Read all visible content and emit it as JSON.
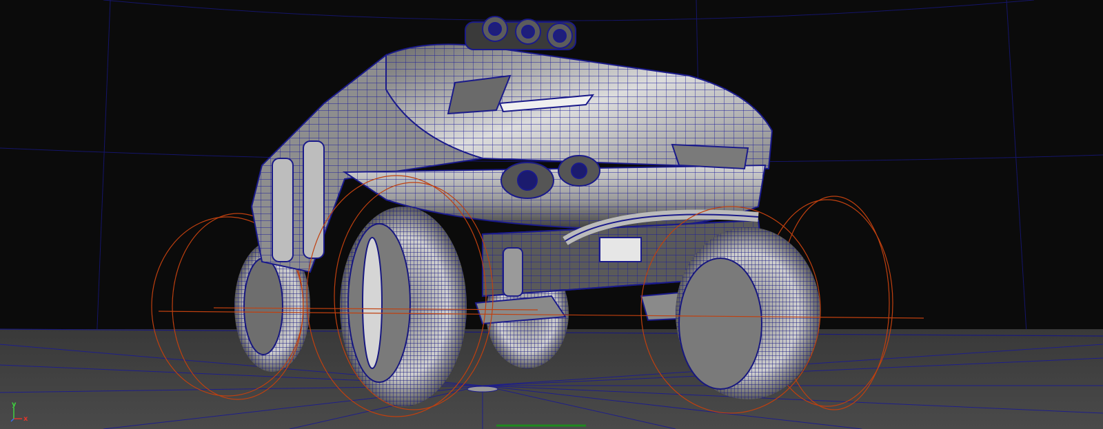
{
  "viewport": {
    "background_color": "#0b0b0b",
    "floor_color": "#444444",
    "wire_color": "#1c1c8c",
    "rig_color": "#c0400f",
    "model_shade_light": "#c9c9c9",
    "model_shade_dark": "#4a4a4a"
  },
  "axis_gizmo": {
    "y_label": "y",
    "x_label": "x",
    "y_color": "#3fd23f",
    "x_color": "#e0362b",
    "z_color": "#3a6df0"
  },
  "model": {
    "icon": "offroad-vehicle-wireframe"
  }
}
